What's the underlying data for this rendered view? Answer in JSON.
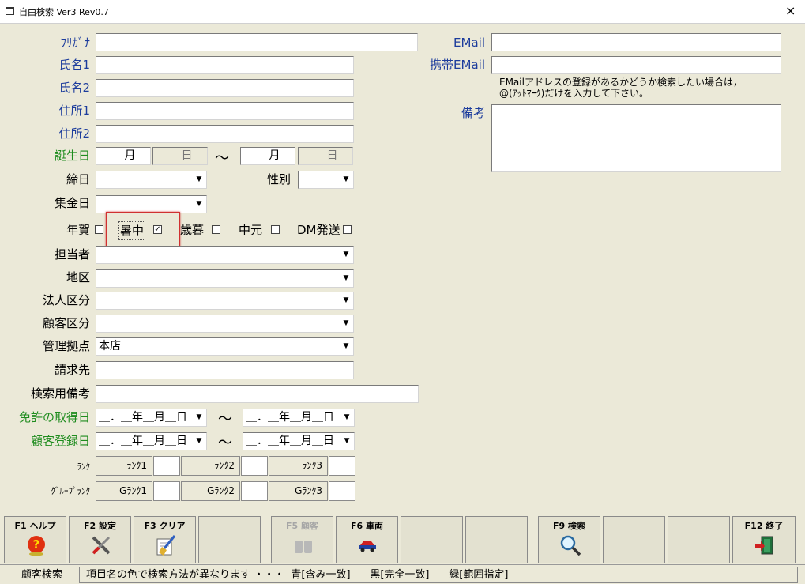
{
  "window": {
    "title": "自由検索 Ver3 Rev0.7",
    "close": "×"
  },
  "labels": {
    "furigana": "ﾌﾘｶﾞﾅ",
    "name1": "氏名1",
    "name2": "氏名2",
    "addr1": "住所1",
    "addr2": "住所2",
    "birthday": "誕生日",
    "closing_day": "締日",
    "gender": "性別",
    "collection_day": "集金日",
    "nenga": "年賀",
    "shochu": "暑中",
    "seibo": "歳暮",
    "chugen": "中元",
    "dm": "DM発送",
    "staff": "担当者",
    "area": "地区",
    "corp_class": "法人区分",
    "cust_class": "顧客区分",
    "base": "管理拠点",
    "billing": "請求先",
    "search_note": "検索用備考",
    "license_date": "免許の取得日",
    "reg_date": "顧客登録日",
    "rank": "ﾗﾝｸ",
    "group_rank": "ｸﾞﾙｰﾌﾟﾗﾝｸ",
    "email": "EMail",
    "mobile_email": "携帯EMail",
    "notes": "備考"
  },
  "values": {
    "furigana": "",
    "name1": "",
    "name2": "",
    "addr1": "",
    "addr2": "",
    "birth_month_from": "＿月",
    "birth_day_from": "＿日",
    "birth_month_to": "＿月",
    "birth_day_to": "＿日",
    "tilde": "～",
    "closing_day": "",
    "gender": "",
    "collection_day": "",
    "staff": "",
    "area": "",
    "corp_class": "",
    "cust_class": "",
    "base": "本店",
    "billing": "",
    "search_note": "",
    "date_mask": "＿．＿年＿月＿日",
    "email": "",
    "mobile_email": "",
    "notes": ""
  },
  "checks": {
    "nenga": false,
    "shochu": true,
    "seibo": false,
    "chugen": false,
    "dm": false,
    "check_mark": "✓"
  },
  "email_hint_line1": "EMailアドレスの登録があるかどうか検索したい場合は，",
  "email_hint_line2": "@(ｱｯﾄﾏｰｸ)だけを入力して下さい。",
  "ranks": [
    "ﾗﾝｸ1",
    "ﾗﾝｸ2",
    "ﾗﾝｸ3"
  ],
  "granks": [
    "Gﾗﾝｸ1",
    "Gﾗﾝｸ2",
    "Gﾗﾝｸ3"
  ],
  "fkeys": {
    "f1": "F1 ヘルプ",
    "f2": "F2 設定",
    "f3": "F3 クリア",
    "f5": "F5 顧客",
    "f6": "F6 車両",
    "f9": "F9 検索",
    "f12": "F12 終了"
  },
  "status": {
    "mode": "顧客検索",
    "message": "項目名の色で検索方法が異なります ・・・  青[含み一致]      黒[完全一致]      緑[範囲指定]"
  },
  "colors": {
    "blue_label": "#1c3c9c",
    "green_label": "#1e8c1e",
    "highlight": "#d03030"
  }
}
